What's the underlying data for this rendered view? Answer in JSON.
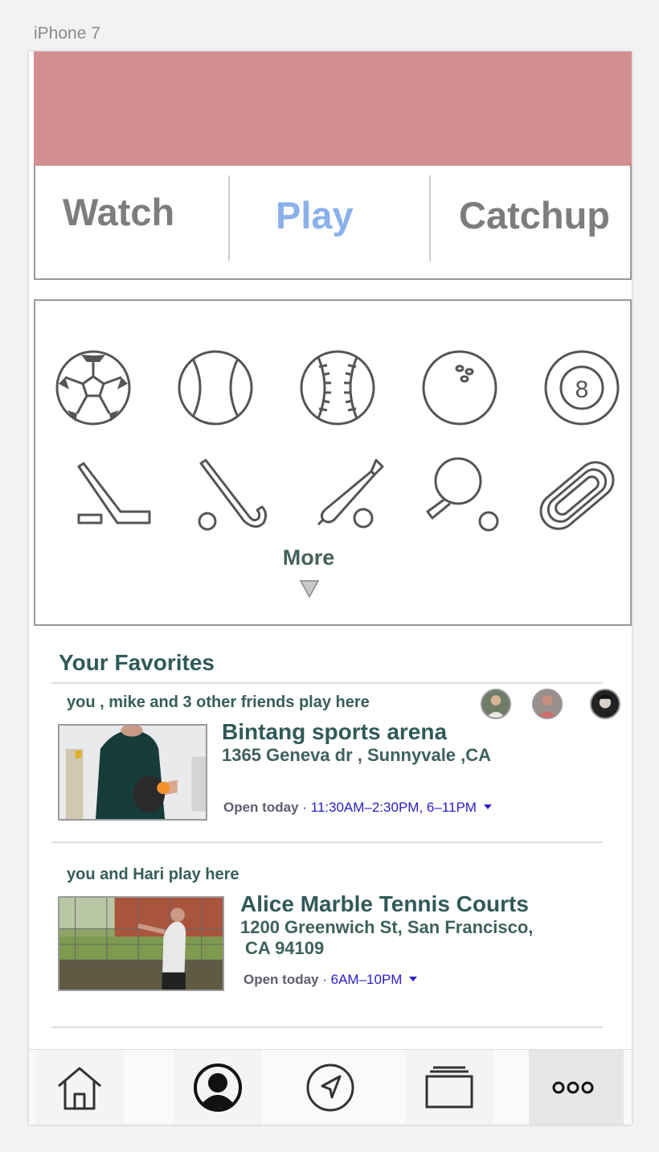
{
  "device_label": "iPhone 7",
  "colors": {
    "header": "#d28f8f",
    "active_tab": "#8ab1ec",
    "tab": "#7d7d7d",
    "accent_text": "#2f5a58",
    "hours_blue": "#2a20c8"
  },
  "tabs": [
    {
      "label": "Watch",
      "active": false
    },
    {
      "label": "Play",
      "active": true
    },
    {
      "label": "Catchup",
      "active": false
    }
  ],
  "sports": {
    "icons": [
      "soccer-ball-icon",
      "tennis-ball-icon",
      "baseball-icon",
      "bowling-ball-icon",
      "eight-ball-icon",
      "ice-hockey-stick-icon",
      "field-hockey-stick-icon",
      "cricket-bat-icon",
      "ping-pong-icon",
      "running-track-icon"
    ],
    "more_label": "More"
  },
  "favorites": {
    "title": "Your Favorites",
    "items": [
      {
        "friends_text": "you , mike and 3 other friends play here",
        "name": "Bintang sports arena",
        "address": "1365 Geneva dr , Sunnyvale ,CA",
        "open_label": "Open today",
        "hours": " · 11:30AM–2:30PM, 6–11PM"
      },
      {
        "friends_text": "you and Hari play here",
        "name": "Alice Marble Tennis Courts",
        "address_line1": "1200 Greenwich St, San Francisco,",
        "address_line2": "CA 94109",
        "open_label": "Open today",
        "hours": " · 6AM–10PM"
      }
    ]
  },
  "tabbar": [
    "home-icon",
    "profile-icon",
    "navigate-icon",
    "cards-icon",
    "more-icon"
  ]
}
